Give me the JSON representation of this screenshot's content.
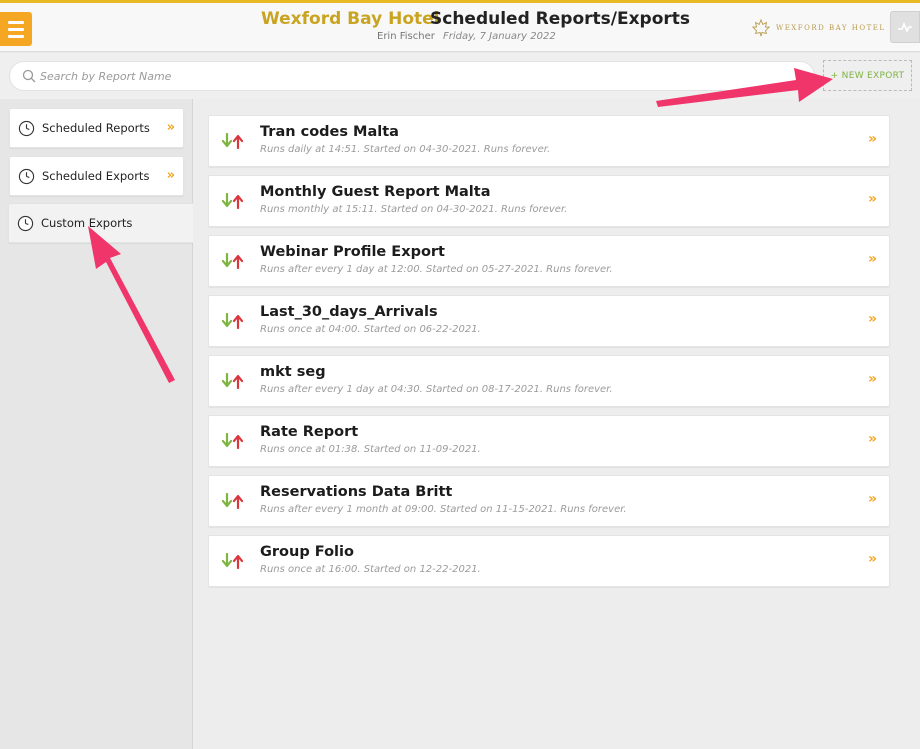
{
  "header": {
    "hotel_name": "Wexford Bay Hotel",
    "page_title": "Scheduled Reports/Exports",
    "user_name": "Erin Fischer",
    "date": "Friday, 7 January 2022",
    "logo_text": "WEXFORD BAY HOTEL"
  },
  "search": {
    "placeholder": "Search by Report Name"
  },
  "toolbar": {
    "new_export_label": "+ NEW EXPORT"
  },
  "sidebar": {
    "items": [
      {
        "label": "Scheduled Reports",
        "active": false
      },
      {
        "label": "Scheduled Exports",
        "active": false
      },
      {
        "label": "Custom Exports",
        "active": true
      }
    ]
  },
  "exports": [
    {
      "title": "Tran codes Malta",
      "schedule": "Runs daily at 14:51. Started on 04-30-2021. Runs forever."
    },
    {
      "title": "Monthly Guest Report Malta",
      "schedule": "Runs monthly at 15:11. Started on 04-30-2021. Runs forever."
    },
    {
      "title": "Webinar Profile Export",
      "schedule": "Runs after every 1 day at 12:00. Started on 05-27-2021. Runs forever."
    },
    {
      "title": "Last_30_days_Arrivals",
      "schedule": "Runs once at 04:00. Started on 06-22-2021."
    },
    {
      "title": "mkt seg",
      "schedule": "Runs after every 1 day at 04:30. Started on 08-17-2021. Runs forever."
    },
    {
      "title": "Rate Report",
      "schedule": "Runs once at 01:38. Started on 11-09-2021."
    },
    {
      "title": "Reservations Data Britt",
      "schedule": "Runs after every 1 month at 09:00. Started on 11-15-2021. Runs forever."
    },
    {
      "title": "Group Folio",
      "schedule": "Runs once at 16:00. Started on 12-22-2021."
    }
  ],
  "colors": {
    "accent_orange": "#f5a623",
    "gold": "#c9a422",
    "green": "#7fb342",
    "red": "#d9363e",
    "annotation_pink": "#f0356b"
  },
  "icons": {
    "menu": "hamburger-icon",
    "activity": "activity-icon",
    "search": "search-icon",
    "clock": "clock-icon",
    "chevron": "double-chevron-right-icon",
    "transfer": "up-down-arrows-icon"
  }
}
